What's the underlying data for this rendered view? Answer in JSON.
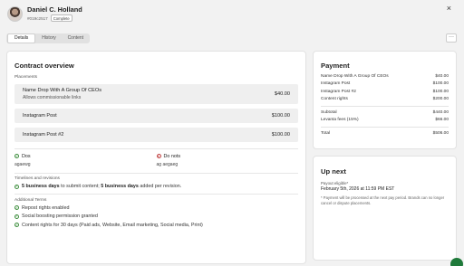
{
  "header": {
    "name": "Daniel C. Holland",
    "identifier": "#019c2517",
    "status": "Complete",
    "close_glyph": "×"
  },
  "tabs": [
    {
      "label": "Details",
      "active": true
    },
    {
      "label": "History",
      "active": false
    },
    {
      "label": "Content",
      "active": false
    }
  ],
  "more_glyph": "···",
  "contract": {
    "title": "Contract overview",
    "placements_label": "Placements",
    "placements": [
      {
        "name": "Name Drop With A Group Of CEOs",
        "description": "Allows commissionable links",
        "price": "$40.00"
      },
      {
        "name": "Instagram Post",
        "description": "",
        "price": "$100.00"
      },
      {
        "name": "Instagram Post #2",
        "description": "",
        "price": "$100.00"
      }
    ],
    "dos_label": "Dos",
    "dos_value": "agaewg",
    "donots_label": "Do nots",
    "donots_value": "ag aegaeg",
    "timelines_label": "Timelines and revisions",
    "timeline": {
      "days1": "5 business days",
      "text1": " to submit content;  ",
      "days2": "5 business days",
      "text2": " added per revision."
    },
    "terms_label": "Additional Terms",
    "terms": [
      "Repost rights enabled",
      "Social boosting permission granted",
      "Content rights for 30 days (Paid ads, Website, Email marketing, Social media, Print)"
    ]
  },
  "payment": {
    "title": "Payment",
    "lines": [
      {
        "label": "Name Drop With A Group Of CEOs",
        "amount": "$40.00"
      },
      {
        "label": "Instagram Post",
        "amount": "$100.00"
      },
      {
        "label": "Instagram Post #2",
        "amount": "$100.00"
      },
      {
        "label": "Content rights",
        "amount": "$200.00"
      }
    ],
    "subtotal_label": "Subtotal",
    "subtotal": "$440.00",
    "fee_label": "Levanta fees (15%)",
    "fee": "$66.00",
    "total_label": "Total",
    "total": "$506.00"
  },
  "upnext": {
    "title": "Up next",
    "payout_label": "Payout eligible*",
    "payout_date": "February 5th, 2026 at 11:59 PM EST",
    "note": "* Payment will be processed at the next pay period. Brands can no longer cancel or dispute placements."
  },
  "colors": {
    "accent_green": "#3b8d3b",
    "danger_red": "#c04040",
    "help_button": "#1f7a3a"
  }
}
